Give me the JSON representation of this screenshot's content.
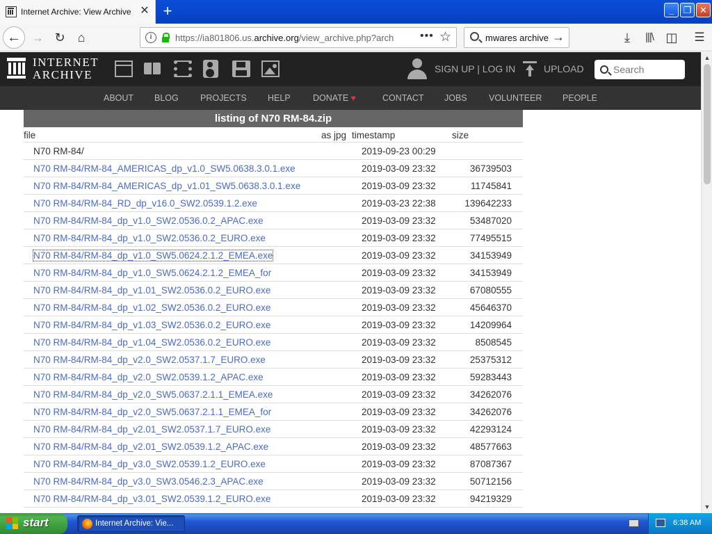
{
  "browser": {
    "tab_title": "Internet Archive: View Archive",
    "url_prefix": "https://ia801806.us.",
    "url_host": "archive.org",
    "url_path": "/view_archive.php?arch",
    "search_query": "mwares archive"
  },
  "ia_header": {
    "logo_line1": "INTERNET",
    "logo_line2": "ARCHIVE",
    "signin": "SIGN UP | LOG IN",
    "upload": "UPLOAD",
    "search_placeholder": "Search"
  },
  "ia_nav": [
    "ABOUT",
    "BLOG",
    "PROJECTS",
    "HELP",
    "DONATE",
    "CONTACT",
    "JOBS",
    "VOLUNTEER",
    "PEOPLE"
  ],
  "listing": {
    "title": "listing of N70 RM-84.zip",
    "columns": {
      "file": "file",
      "as_jpg": "as jpg",
      "timestamp": "timestamp",
      "size": "size"
    },
    "rows": [
      {
        "file": "N70 RM-84/",
        "timestamp": "2019-09-23 00:29",
        "size": ""
      },
      {
        "file": "N70 RM-84/RM-84_AMERICAS_dp_v1.0_SW5.0638.3.0.1.exe",
        "timestamp": "2019-03-09 23:32",
        "size": "36739503"
      },
      {
        "file": "N70 RM-84/RM-84_AMERICAS_dp_v1.01_SW5.0638.3.0.1.exe",
        "timestamp": "2019-03-09 23:32",
        "size": "11745841"
      },
      {
        "file": "N70 RM-84/RM-84_RD_dp_v16.0_SW2.0539.1.2.exe",
        "timestamp": "2019-03-23 22:38",
        "size": "139642233"
      },
      {
        "file": "N70 RM-84/RM-84_dp_v1.0_SW2.0536.0.2_APAC.exe",
        "timestamp": "2019-03-09 23:32",
        "size": "53487020"
      },
      {
        "file": "N70 RM-84/RM-84_dp_v1.0_SW2.0536.0.2_EURO.exe",
        "timestamp": "2019-03-09 23:32",
        "size": "77495515"
      },
      {
        "file": "N70 RM-84/RM-84_dp_v1.0_SW5.0624.2.1.2_EMEA.exe",
        "timestamp": "2019-03-09 23:32",
        "size": "34153949"
      },
      {
        "file": "N70 RM-84/RM-84_dp_v1.0_SW5.0624.2.1.2_EMEA_for",
        "timestamp": "2019-03-09 23:32",
        "size": "34153949"
      },
      {
        "file": "N70 RM-84/RM-84_dp_v1.01_SW2.0536.0.2_EURO.exe",
        "timestamp": "2019-03-09 23:32",
        "size": "67080555"
      },
      {
        "file": "N70 RM-84/RM-84_dp_v1.02_SW2.0536.0.2_EURO.exe",
        "timestamp": "2019-03-09 23:32",
        "size": "45646370"
      },
      {
        "file": "N70 RM-84/RM-84_dp_v1.03_SW2.0536.0.2_EURO.exe",
        "timestamp": "2019-03-09 23:32",
        "size": "14209964"
      },
      {
        "file": "N70 RM-84/RM-84_dp_v1.04_SW2.0536.0.2_EURO.exe",
        "timestamp": "2019-03-09 23:32",
        "size": "8508545"
      },
      {
        "file": "N70 RM-84/RM-84_dp_v2.0_SW2.0537.1.7_EURO.exe",
        "timestamp": "2019-03-09 23:32",
        "size": "25375312"
      },
      {
        "file": "N70 RM-84/RM-84_dp_v2.0_SW2.0539.1.2_APAC.exe",
        "timestamp": "2019-03-09 23:32",
        "size": "59283443"
      },
      {
        "file": "N70 RM-84/RM-84_dp_v2.0_SW5.0637.2.1.1_EMEA.exe",
        "timestamp": "2019-03-09 23:32",
        "size": "34262076"
      },
      {
        "file": "N70 RM-84/RM-84_dp_v2.0_SW5.0637.2.1.1_EMEA_for",
        "timestamp": "2019-03-09 23:32",
        "size": "34262076"
      },
      {
        "file": "N70 RM-84/RM-84_dp_v2.01_SW2.0537.1.7_EURO.exe",
        "timestamp": "2019-03-09 23:32",
        "size": "42293124"
      },
      {
        "file": "N70 RM-84/RM-84_dp_v2.01_SW2.0539.1.2_APAC.exe",
        "timestamp": "2019-03-09 23:32",
        "size": "48577663"
      },
      {
        "file": "N70 RM-84/RM-84_dp_v3.0_SW2.0539.1.2_EURO.exe",
        "timestamp": "2019-03-09 23:32",
        "size": "87087367"
      },
      {
        "file": "N70 RM-84/RM-84_dp_v3.0_SW3.0546.2.3_APAC.exe",
        "timestamp": "2019-03-09 23:32",
        "size": "50712156"
      },
      {
        "file": "N70 RM-84/RM-84_dp_v3.01_SW2.0539.1.2_EURO.exe",
        "timestamp": "2019-03-09 23:32",
        "size": "94219329"
      }
    ]
  },
  "taskbar": {
    "start_label": "start",
    "task_label": "Internet Archive: Vie...",
    "clock": "6:38 AM"
  },
  "colors": {
    "link": "#4a6bc8",
    "ia_dark": "#222222",
    "listing_title_bg": "#666666",
    "donate_heart": "#e0323c"
  }
}
